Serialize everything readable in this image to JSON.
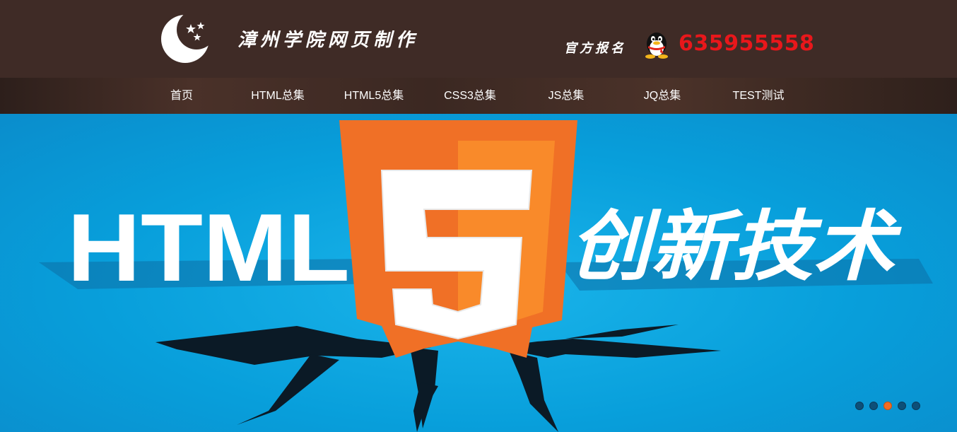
{
  "header": {
    "site_title": "漳州学院网页制作",
    "signup_label": "官方报名",
    "qq_number": "635955558",
    "icons": {
      "logo": "moon-stars-logo",
      "qq": "qq-penguin-icon"
    }
  },
  "nav": {
    "items": [
      {
        "label": "首页"
      },
      {
        "label": "HTML总集"
      },
      {
        "label": "HTML5总集"
      },
      {
        "label": "CSS3总集"
      },
      {
        "label": "JS总集"
      },
      {
        "label": "JQ总集"
      },
      {
        "label": "TEST测试"
      }
    ]
  },
  "banner": {
    "left_text": "HTML",
    "shield_digit": "5",
    "right_text": "创新技术",
    "slides": {
      "count": 5,
      "active_index": 2
    }
  },
  "colors": {
    "header_bg": "#3f2b26",
    "banner_blue": "#089fdb",
    "html5_orange": "#f07026",
    "html5_orange_light": "#f98a2a",
    "qq_red": "#e8171b",
    "active_dot": "#f26c21"
  }
}
